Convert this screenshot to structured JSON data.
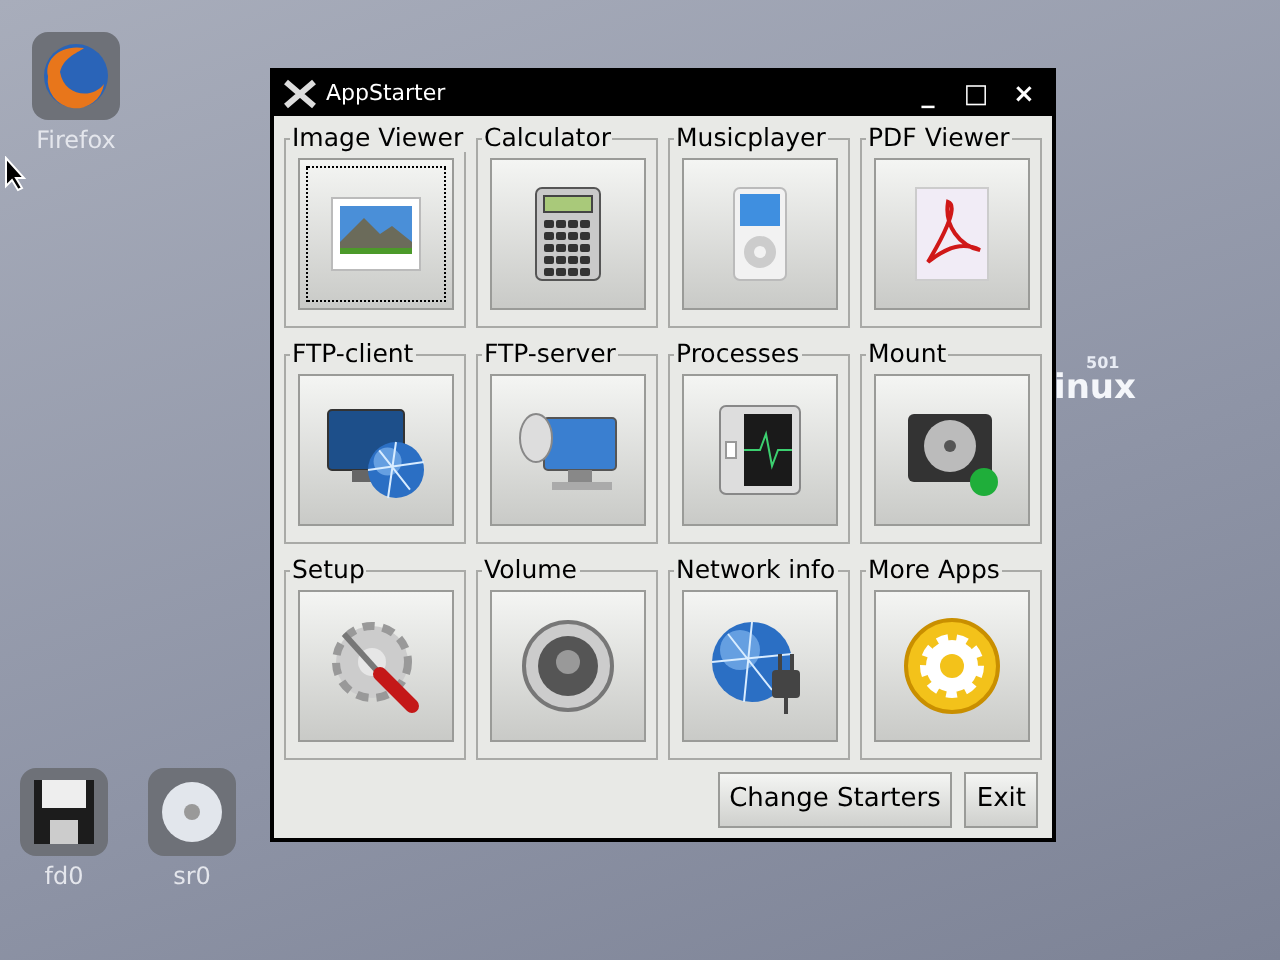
{
  "desktop_icons": [
    {
      "kind": "firefox",
      "label": "Firefox"
    },
    {
      "kind": "floppy",
      "label": "fd0"
    },
    {
      "kind": "cdrom",
      "label": "sr0"
    }
  ],
  "wallpaper_text": {
    "version": "501",
    "word": "inux"
  },
  "window": {
    "title": "AppStarter",
    "controls": [
      "_",
      "□",
      "×"
    ]
  },
  "starters": [
    {
      "label": "Image Viewer",
      "kind": "image",
      "focused": true
    },
    {
      "label": "Calculator",
      "kind": "calculator",
      "focused": false
    },
    {
      "label": "Musicplayer",
      "kind": "music",
      "focused": false
    },
    {
      "label": "PDF Viewer",
      "kind": "pdf",
      "focused": false
    },
    {
      "label": "FTP-client",
      "kind": "ftpclient",
      "focused": false
    },
    {
      "label": "FTP-server",
      "kind": "ftpserver",
      "focused": false
    },
    {
      "label": "Processes",
      "kind": "processes",
      "focused": false
    },
    {
      "label": "Mount",
      "kind": "mount",
      "focused": false
    },
    {
      "label": "Setup",
      "kind": "setup",
      "focused": false
    },
    {
      "label": "Volume",
      "kind": "volume",
      "focused": false
    },
    {
      "label": "Network info",
      "kind": "network",
      "focused": false
    },
    {
      "label": "More Apps",
      "kind": "more",
      "focused": false
    }
  ],
  "buttons": [
    "Change Starters",
    "Exit"
  ]
}
